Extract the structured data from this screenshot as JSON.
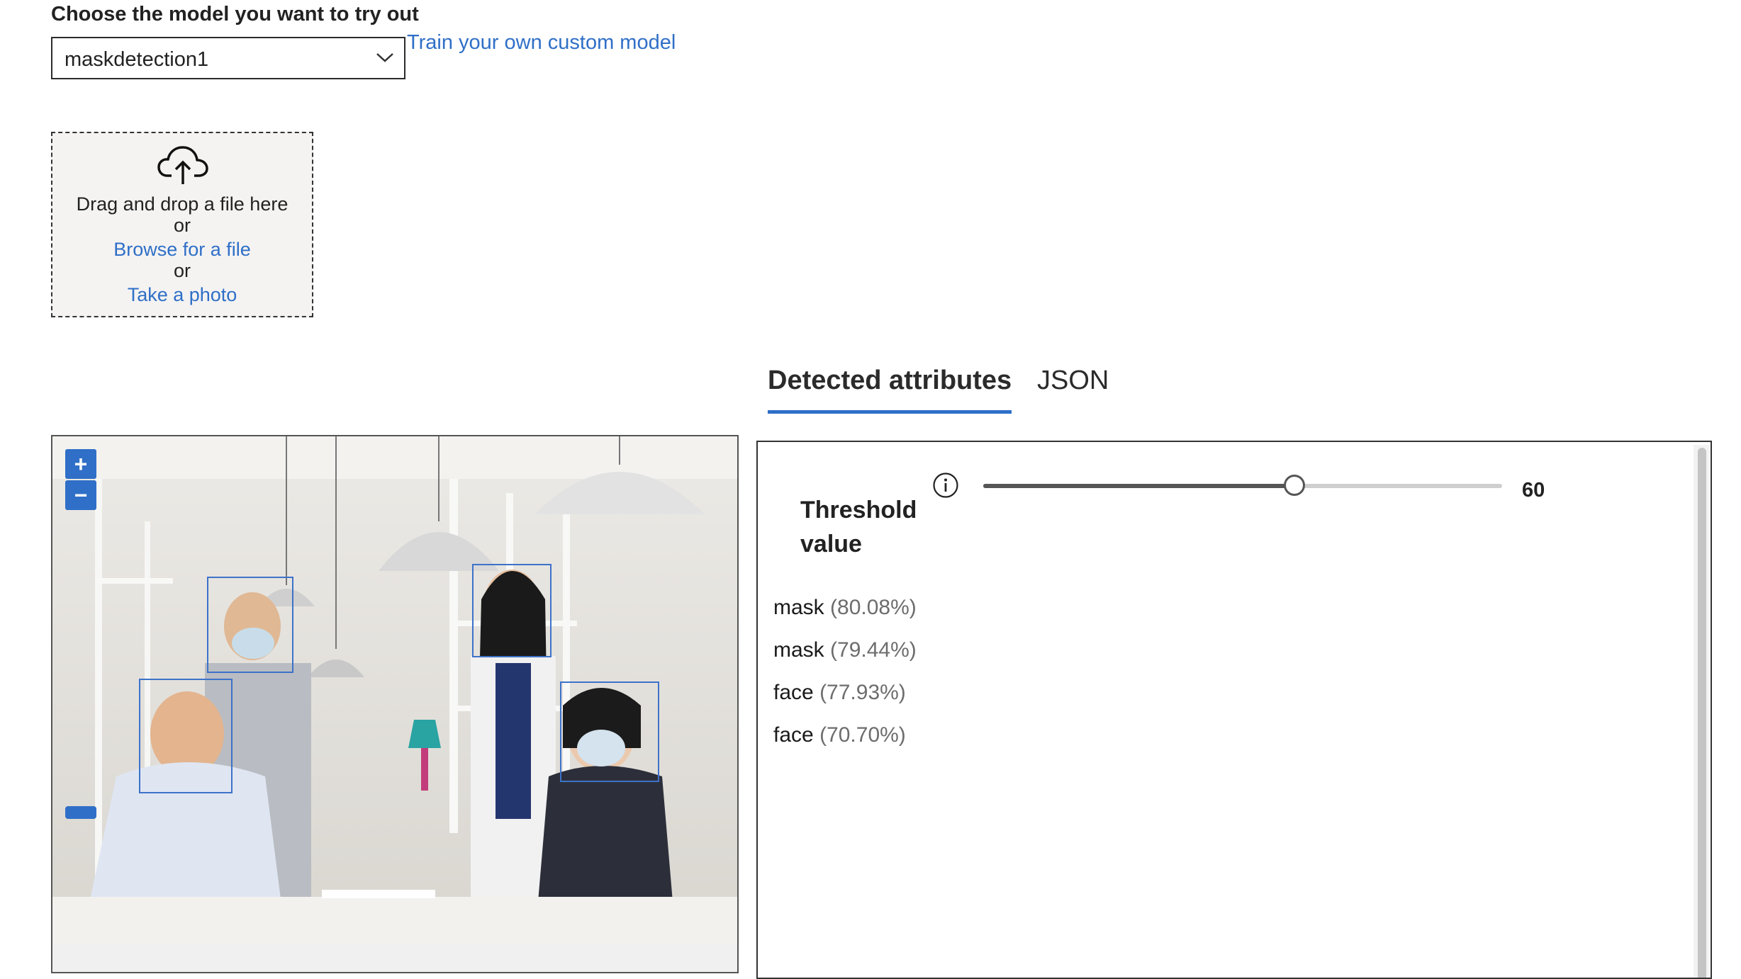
{
  "model": {
    "heading": "Choose the model you want to try out",
    "selected": "maskdetection1",
    "train_link": "Train your own custom model"
  },
  "upload": {
    "drag_text": "Drag and drop a file here",
    "or_1": "or",
    "browse_link": "Browse for a file",
    "or_2": "or",
    "photo_link": "Take a photo"
  },
  "tabs": [
    {
      "label": "Detected attributes",
      "active": true
    },
    {
      "label": "JSON",
      "active": false
    }
  ],
  "viewer": {
    "zoom_in": "+",
    "zoom_out": "−",
    "image_alt": "Office team photo with detection boxes"
  },
  "results": {
    "threshold_label": "Threshold value",
    "threshold_value": "60",
    "threshold_fraction": 0.6,
    "detections": [
      {
        "label": "mask",
        "confidence": "(80.08%)"
      },
      {
        "label": "mask",
        "confidence": "(79.44%)"
      },
      {
        "label": "face",
        "confidence": "(77.93%)"
      },
      {
        "label": "face",
        "confidence": "(70.70%)"
      }
    ]
  },
  "colors": {
    "accent": "#2f6fc7",
    "box_outline": "#3d72c9"
  },
  "icons": {
    "dropdown": "chevron-down-icon",
    "upload": "cloud-upload-icon",
    "info": "info-icon"
  }
}
